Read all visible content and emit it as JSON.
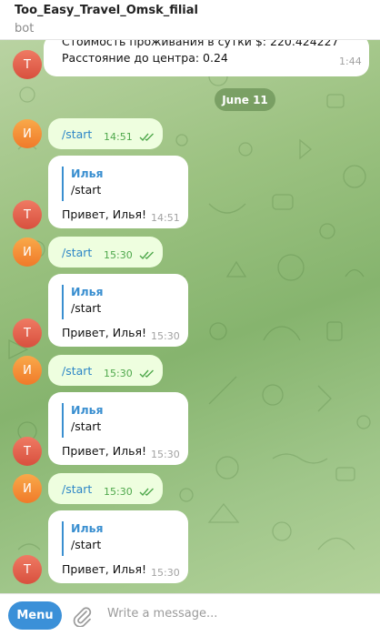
{
  "header": {
    "title": "Too_Easy_Travel_Omsk_filial",
    "subtitle": "bot"
  },
  "top_message": {
    "avatar": "Т",
    "line1": "Стоимость проживания в сутки $: 220.424227",
    "line2": "Расстояние до центра: 0.24",
    "time": "1:44"
  },
  "date_separator": "June 11",
  "conversation": [
    {
      "user": {
        "avatar": "И",
        "text": "/start",
        "time": "14:51"
      },
      "bot": {
        "avatar": "Т",
        "quote_name": "Илья",
        "quote_text": "/start",
        "text": "Привет, Илья!",
        "time": "14:51"
      }
    },
    {
      "user": {
        "avatar": "И",
        "text": "/start",
        "time": "15:30"
      },
      "bot": {
        "avatar": "Т",
        "quote_name": "Илья",
        "quote_text": "/start",
        "text": "Привет, Илья!",
        "time": "15:30"
      }
    },
    {
      "user": {
        "avatar": "И",
        "text": "/start",
        "time": "15:30"
      },
      "bot": {
        "avatar": "Т",
        "quote_name": "Илья",
        "quote_text": "/start",
        "text": "Привет, Илья!",
        "time": "15:30"
      }
    },
    {
      "user": {
        "avatar": "И",
        "text": "/start",
        "time": "15:30"
      },
      "bot": {
        "avatar": "Т",
        "quote_name": "Илья",
        "quote_text": "/start",
        "text": "Привет, Илья!",
        "time": "15:30"
      }
    }
  ],
  "composer": {
    "menu_label": "Menu",
    "placeholder": "Write a message...",
    "attach_icon": "paperclip-icon"
  },
  "colors": {
    "accent": "#3b90d8",
    "outgoing_bubble": "#eefedf",
    "check": "#4fa84c",
    "bot_avatar": "#e0604a",
    "user_avatar": "#f5902f"
  }
}
